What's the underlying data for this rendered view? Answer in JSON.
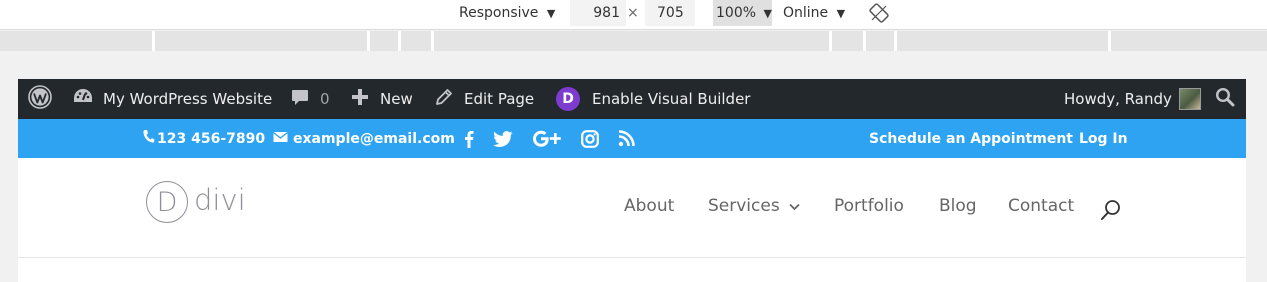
{
  "devtools": {
    "mode": "Responsive",
    "width": "981",
    "times": "×",
    "height": "705",
    "zoom": "100%",
    "network": "Online",
    "caret": "▼"
  },
  "adminbar": {
    "site_name": "My WordPress Website",
    "comments_count": "0",
    "new_label": "New",
    "edit_label": "Edit Page",
    "divi_letter": "D",
    "visual_builder_label": "Enable Visual Builder",
    "howdy": "Howdy, Randy"
  },
  "topbar": {
    "phone": "123 456-7890",
    "email": "example@email.com",
    "appointment": "Schedule an Appointment",
    "login": "Log In"
  },
  "header": {
    "logo_letter": "D",
    "logo_text": "divi",
    "nav": {
      "about": "About",
      "services": "Services",
      "portfolio": "Portfolio",
      "blog": "Blog",
      "contact": "Contact"
    }
  },
  "colors": {
    "adminbar_bg": "#23282d",
    "topbar_bg": "#2ea3f2",
    "divi_purple": "#7e3bd0",
    "nav_text": "#666666"
  }
}
